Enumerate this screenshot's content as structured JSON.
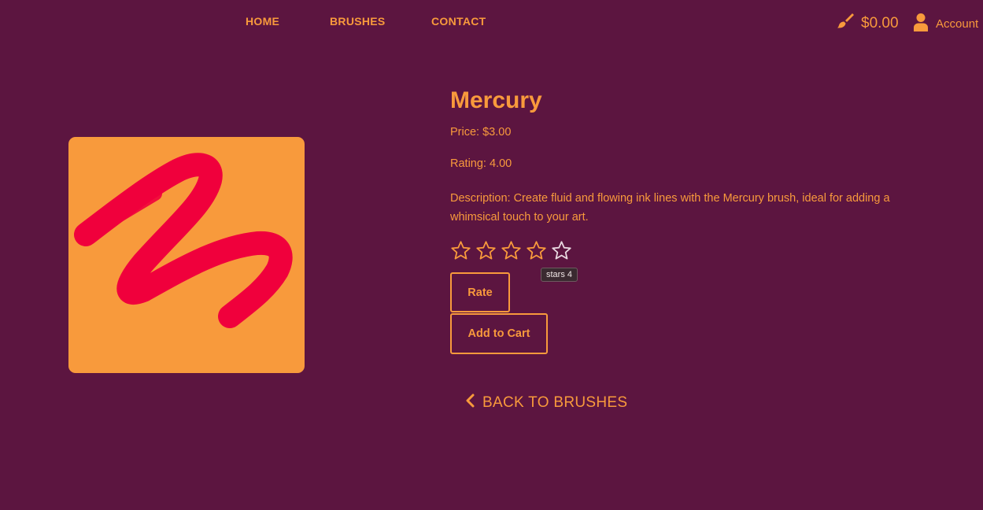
{
  "nav": {
    "items": [
      {
        "label": "HOME"
      },
      {
        "label": "BRUSHES"
      },
      {
        "label": "CONTACT"
      }
    ]
  },
  "header": {
    "cart_total": "$0.00",
    "cart_icon": "paintbrush-icon",
    "account_label": "Account",
    "account_icon": "user-icon"
  },
  "product": {
    "name": "Mercury",
    "price": "Price: $3.00",
    "rating": "Rating: 4.00",
    "description": "Description: Create fluid and flowing ink lines with the Mercury brush, ideal for adding a whimsical touch to your art.",
    "image_icon": "red-brush-stroke",
    "stars_total": 5,
    "stars_hover": 4,
    "tooltip": "stars 4"
  },
  "buttons": {
    "rate": "Rate",
    "add_to_cart": "Add to Cart",
    "back": "BACK TO BRUSHES"
  },
  "colors": {
    "background": "#5c1540",
    "accent": "#f89a3c",
    "stroke": "#f0003c"
  }
}
